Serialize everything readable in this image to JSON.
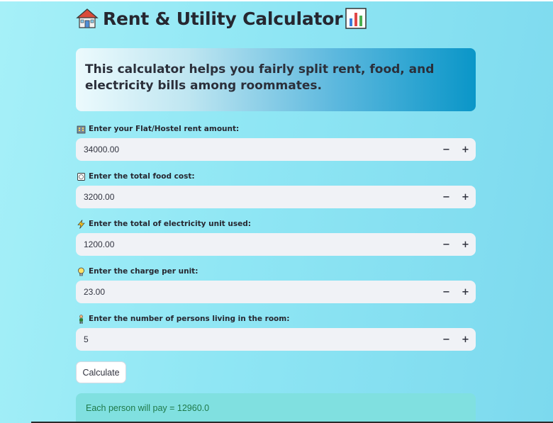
{
  "title": {
    "text": "Rent & Utility Calculator",
    "leading_icon": "house-icon",
    "trailing_icon": "bar-chart-icon"
  },
  "intro": {
    "text": "This calculator helps you fairly split rent, food, and electricity bills among roommates."
  },
  "fields": [
    {
      "label": "Enter your Flat/Hostel rent amount:",
      "icon": "building-icon",
      "value": "34000.00"
    },
    {
      "label": "Enter the total food cost:",
      "icon": "plate-cutlery-icon",
      "value": "3200.00"
    },
    {
      "label": "Enter the total of electricity unit used:",
      "icon": "lightning-icon",
      "value": "1200.00"
    },
    {
      "label": "Enter the charge per unit:",
      "icon": "light-bulb-icon",
      "value": "23.00"
    },
    {
      "label": "Enter the number of persons living in the room:",
      "icon": "person-icon",
      "value": "5"
    }
  ],
  "stepper": {
    "minus": "−",
    "plus": "+"
  },
  "calculate_button": {
    "label": "Calculate"
  },
  "result": {
    "text": "Each person will pay = 12960.0"
  },
  "colors": {
    "background": "#8fe6f4",
    "input_bg": "#f0f2f6",
    "result_bg": "#80e0e0",
    "result_text": "#1f7a4a",
    "intro_gradient_end": "#0a96c8"
  }
}
